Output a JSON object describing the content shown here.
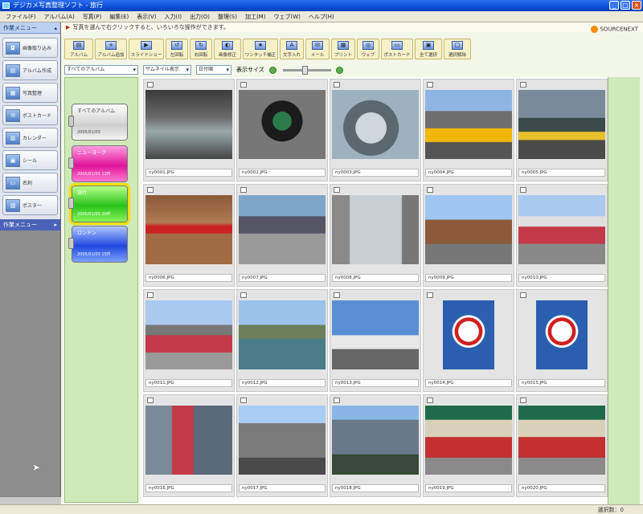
{
  "window": {
    "title": "デジカメ写真整理ソフト - 旅行"
  },
  "menu": [
    "ファイル(F)",
    "アルバム(A)",
    "写真(P)",
    "編集(E)",
    "表示(V)",
    "入力(I)",
    "出力(O)",
    "整理(S)",
    "加工(M)",
    "ウェブ(W)",
    "ヘルプ(H)"
  ],
  "left_panel": {
    "header": "作業メニュー",
    "items": [
      "画像取り込み",
      "アルバム作成",
      "写真整理",
      "ポストカード",
      "カレンダー",
      "シール",
      "名刺",
      "ポスター"
    ],
    "header2": "作業メニュー",
    "colors": {
      "panel": "#8d8d8d",
      "header2": "#4a63b8"
    }
  },
  "info_text": "写真を選んで右クリックすると、いろいろな操作ができます。",
  "brand": "SOURCENEXT",
  "toolbar": [
    "アルバム",
    "アルバム追加",
    "スライドショー",
    "左回転",
    "右回転",
    "画像修正",
    "ワンタッチ補正",
    "文字入れ",
    "メール",
    "プリント",
    "ウェブ",
    "ポストカード",
    "全て選択",
    "選択解除"
  ],
  "filter": {
    "album_select": "すべてのアルバム",
    "view_select": "サムネイル表示",
    "sort_select": "日付順",
    "size_label": "表示サイズ"
  },
  "albums": [
    {
      "title": "すべてのアルバム",
      "date": "2005/01/03"
    },
    {
      "title": "ニューヨーク",
      "date": "2005/01/03 12件"
    },
    {
      "title": "旅行",
      "date": "2005/01/03 20件"
    },
    {
      "title": "ロンドン",
      "date": "2005/01/03 15件"
    }
  ],
  "photos": [
    {
      "file": "ny0001.JPG",
      "scene": "subway"
    },
    {
      "file": "ny0002.JPG",
      "scene": "atm"
    },
    {
      "file": "ny0003.JPG",
      "scene": "sphere"
    },
    {
      "file": "ny0004.JPG",
      "scene": "taxi"
    },
    {
      "file": "ny0005.JPG",
      "scene": "taxi2"
    },
    {
      "file": "ny0006.JPG",
      "scene": "wall"
    },
    {
      "file": "ny0007.JPG",
      "scene": "street"
    },
    {
      "file": "ny0008.JPG",
      "scene": "phone"
    },
    {
      "file": "ny0009.JPG",
      "scene": "avenue"
    },
    {
      "file": "ny0010.JPG",
      "scene": "tram"
    },
    {
      "file": "ny0011.JPG",
      "scene": "tram2"
    },
    {
      "file": "ny0012.JPG",
      "scene": "river"
    },
    {
      "file": "ny0013.JPG",
      "scene": "sign"
    },
    {
      "file": "ny0014.JPG",
      "scene": "signtall"
    },
    {
      "file": "ny0015.JPG",
      "scene": "signtall"
    },
    {
      "file": "ny0016.JPG",
      "scene": "tramview"
    },
    {
      "file": "ny0017.JPG",
      "scene": "skyline"
    },
    {
      "file": "ny0018.JPG",
      "scene": "skyline2"
    },
    {
      "file": "ny0019.JPG",
      "scene": "shop"
    },
    {
      "file": "ny0020.JPG",
      "scene": "shop"
    }
  ],
  "status_text": "選択数：0"
}
